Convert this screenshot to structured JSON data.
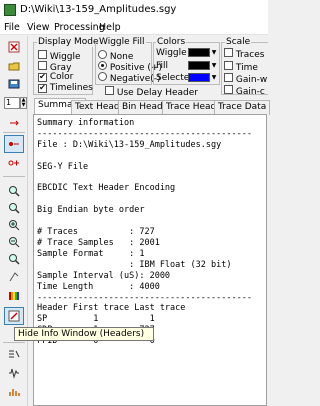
{
  "window": {
    "title": "D:\\Wiki\\13-159_Amplitudes.sgy"
  },
  "menu": [
    "File",
    "View",
    "Processing",
    "Help"
  ],
  "display_mode": {
    "title": "Display Mode",
    "options": [
      {
        "label": "Wiggle",
        "checked": false
      },
      {
        "label": "Gray",
        "checked": false
      },
      {
        "label": "Color",
        "checked": true
      },
      {
        "label": "Timelines",
        "checked": true
      }
    ]
  },
  "wiggle_fill": {
    "title": "Wiggle Fill",
    "options": [
      {
        "label": "None",
        "selected": false
      },
      {
        "label": "Positive (+)",
        "selected": true
      },
      {
        "label": "Negative(-)",
        "selected": false
      }
    ],
    "use_delay_header": "Use Delay Header"
  },
  "colors": {
    "title": "Colors",
    "rows": [
      {
        "label": "Wiggle",
        "color": "#000000"
      },
      {
        "label": "Fill",
        "color": "#000000"
      },
      {
        "label": "Selected",
        "color": "#0000ff"
      }
    ]
  },
  "scale": {
    "title": "Scale",
    "rows": [
      {
        "label": "Traces",
        "checked": false
      },
      {
        "label": "Time",
        "checked": false
      },
      {
        "label": "Gain-w",
        "checked": false
      },
      {
        "label": "Gain-c",
        "checked": false
      }
    ]
  },
  "trace_input": "1",
  "tabs": [
    "Summary",
    "Text Header",
    "Bin Header",
    "Trace Header",
    "Trace Data"
  ],
  "active_tab": "Summary",
  "summary_lines": [
    "Summary information",
    "------------------------------------------",
    "File : D:\\Wiki\\13-159_Amplitudes.sgy",
    "",
    "SEG-Y File",
    "",
    "EBCDIC Text Header Encoding",
    "",
    "Big Endian byte order",
    "",
    "# Traces          : 727",
    "# Trace Samples   : 2001",
    "Sample Format     : 1",
    "                  : IBM Float (32 bit)",
    "Sample Interval (uS): 2000",
    "Time Length       : 4000",
    "------------------------------------------",
    "Header First trace Last trace",
    "SP         1          1",
    "CDP        1        727",
    "FFID       0          0"
  ],
  "tooltip": "Hide Info Window (Headers)",
  "toolbar_icons": [
    "new-file-icon",
    "open-file-icon",
    "save-icon",
    "cut-icon",
    "print-icon",
    "pointer-icon",
    "select-trace-icon",
    "crosshair-icon",
    "zoom-icon",
    "zoom-area-icon",
    "zoom-in-icon",
    "zoom-out-icon",
    "zoom-reset-icon",
    "text-tool-icon",
    "color-bar-icon",
    "info-window-icon",
    "header-icon",
    "wavelet-icon",
    "spectrum-icon"
  ]
}
